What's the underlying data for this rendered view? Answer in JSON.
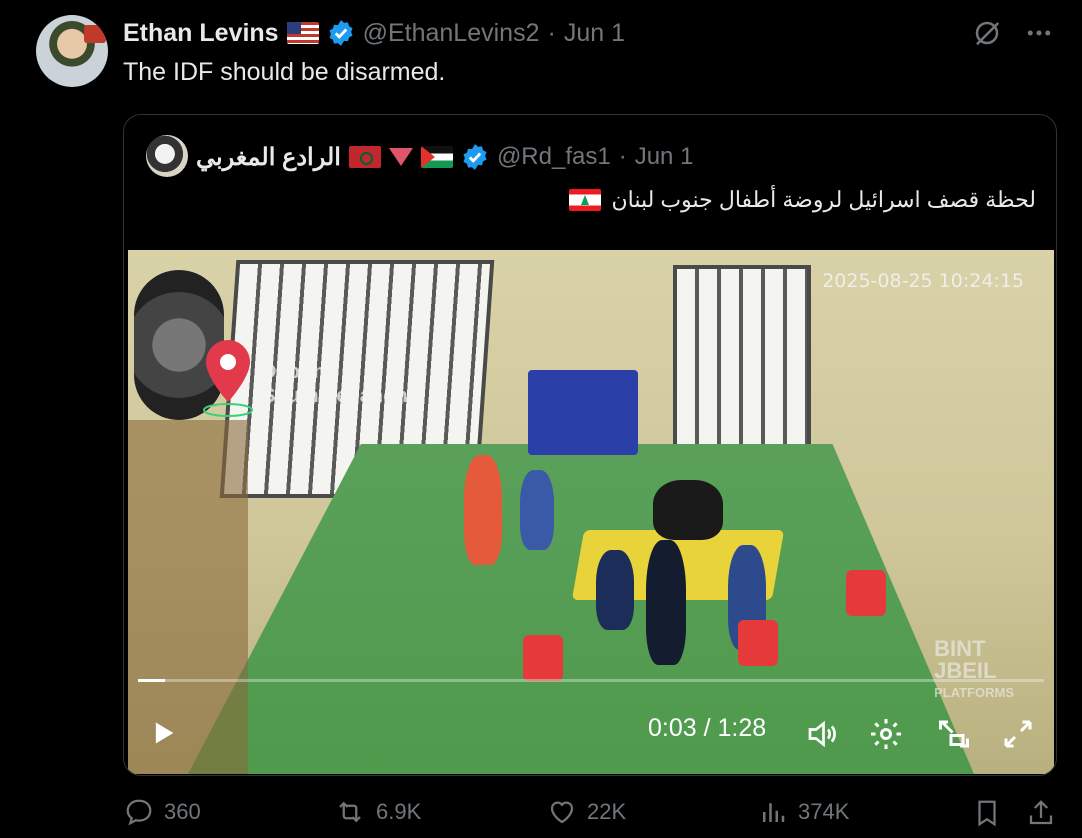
{
  "tweet": {
    "author_name": "Ethan Levins",
    "flag_emoji": "🇺🇸",
    "handle": "@EthanLevins2",
    "date": "Jun 1",
    "text": "The IDF should be disarmed."
  },
  "quote": {
    "author_name": "الرادع المغربي",
    "handle": "@Rd_fas1",
    "date": "Jun 1",
    "text": "لحظة قصف اسرائيل لروضة أطفال جنوب لبنان"
  },
  "video": {
    "timestamp": "2025-08-25 10:24:15",
    "location_label_line1": "Dabrine",
    "location_label_line2": "South Lebanon",
    "brand_line1": "BINT",
    "brand_line2": "JBEIL",
    "brand_line3": "PLATFORMS",
    "time_display": "0:03 / 1:28",
    "progress_fraction": 0.03
  },
  "actions": {
    "replies": "360",
    "reposts": "6.9K",
    "likes": "22K",
    "views": "374K"
  },
  "colors": {
    "verified": "#1d9bf0",
    "muted": "#71767b",
    "background": "#000000"
  }
}
